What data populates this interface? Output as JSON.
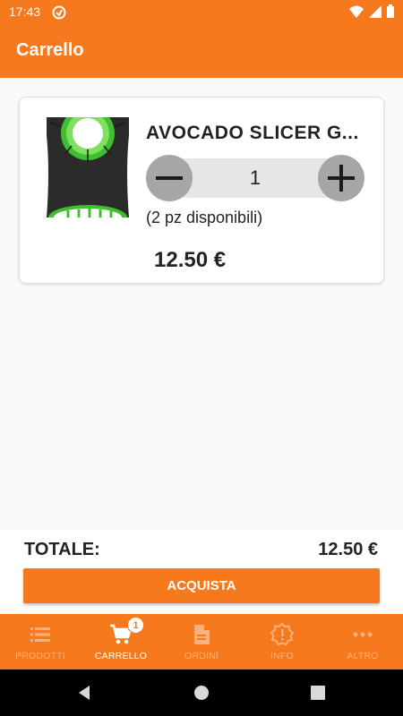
{
  "status_bar": {
    "time": "17:43"
  },
  "app_bar": {
    "title": "Carrello"
  },
  "cart": {
    "items": [
      {
        "name": "AVOCADO SLICER G...",
        "quantity": "1",
        "availability": "(2 pz disponibili)",
        "price": "12.50 €"
      }
    ]
  },
  "summary": {
    "total_label": "TOTALE:",
    "total_value": "12.50 €",
    "buy_label": "ACQUISTA"
  },
  "bottom_nav": {
    "items": [
      {
        "label": "PRODOTTI",
        "icon": "list-icon",
        "active": false
      },
      {
        "label": "CARRELLO",
        "icon": "cart-icon",
        "active": true,
        "badge": "1"
      },
      {
        "label": "ORDINI",
        "icon": "document-icon",
        "active": false
      },
      {
        "label": "INFO",
        "icon": "alert-badge-icon",
        "active": false
      },
      {
        "label": "ALTRO",
        "icon": "more-dots-icon",
        "active": false
      }
    ]
  },
  "colors": {
    "primary": "#f7791d",
    "inactive_nav_label": "#f9b27c",
    "stepper_button": "#a6a6a6",
    "stepper_track": "#e6e6e6"
  }
}
